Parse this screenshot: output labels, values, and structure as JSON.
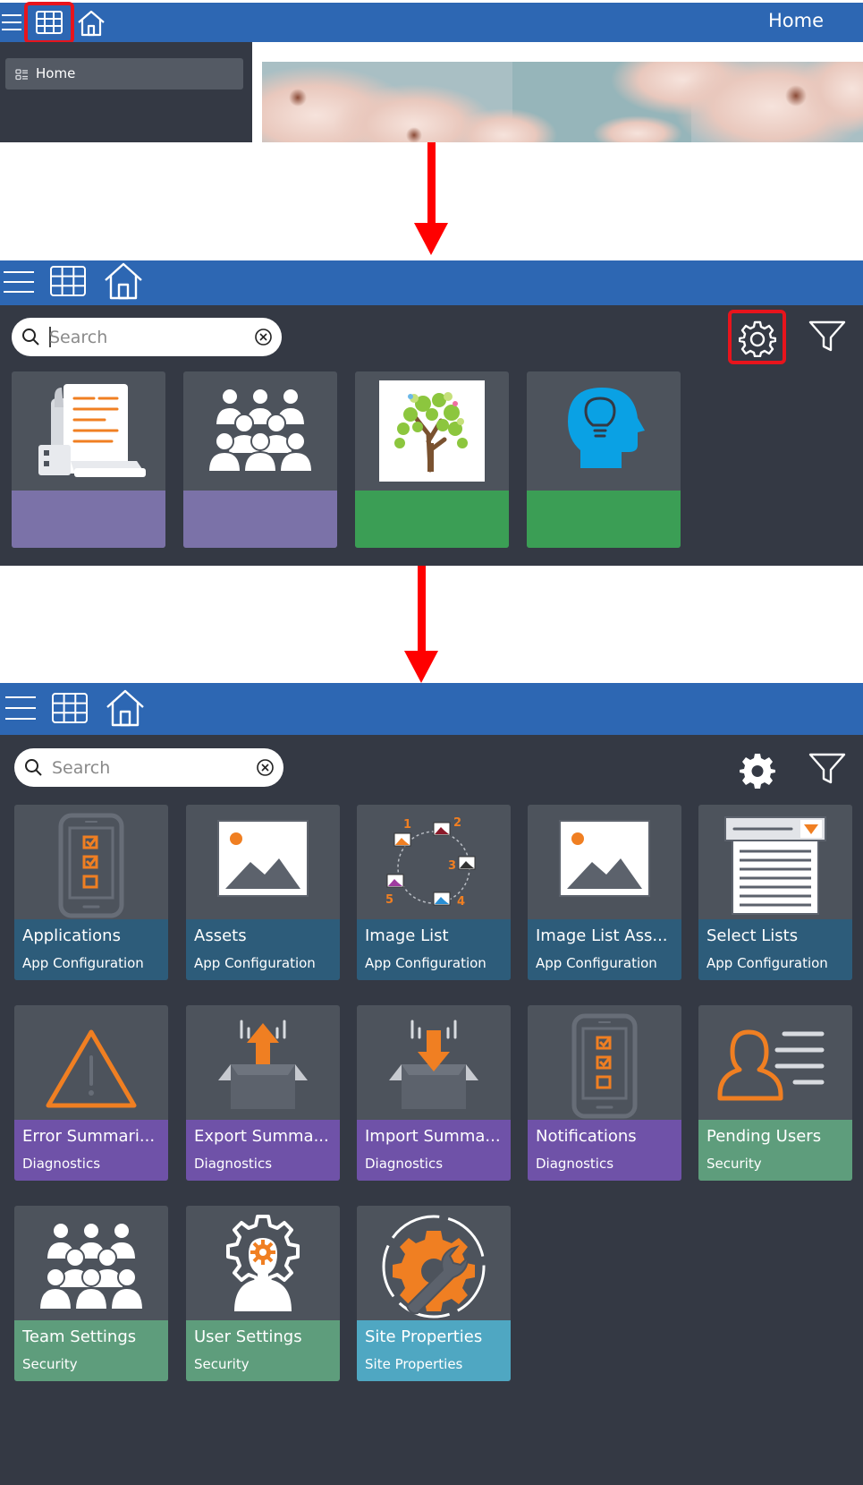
{
  "panel1": {
    "title": "Home",
    "sidebar": {
      "items": [
        {
          "label": "Home",
          "icon": "dashboard-icon"
        }
      ]
    },
    "topbar_icons": [
      "menu-icon",
      "grid-icon",
      "home-icon"
    ]
  },
  "panel2": {
    "search": {
      "placeholder": "Search",
      "value": ""
    },
    "tiles": [
      {
        "icon": "document-hands-icon",
        "band_color": "#7b72a8"
      },
      {
        "icon": "team-people-icon",
        "band_color": "#7b72a8"
      },
      {
        "icon": "tree-image-icon",
        "band_color": "#3b9e55"
      },
      {
        "icon": "lightbulb-head-icon",
        "band_color": "#3b9e55"
      }
    ]
  },
  "panel3": {
    "search": {
      "placeholder": "Search",
      "value": ""
    },
    "tiles": [
      {
        "title": "Applications",
        "category": "App Configuration",
        "icon": "phone-checklist-icon",
        "band_color": "#2d5c7a"
      },
      {
        "title": "Assets",
        "category": "App Configuration",
        "icon": "image-icon",
        "band_color": "#2d5c7a"
      },
      {
        "title": "Image List",
        "category": "App Configuration",
        "icon": "image-cycle-icon",
        "band_color": "#2d5c7a"
      },
      {
        "title": "Image List Ass...",
        "category": "App Configuration",
        "icon": "image-icon",
        "band_color": "#2d5c7a"
      },
      {
        "title": "Select Lists",
        "category": "App Configuration",
        "icon": "select-list-icon",
        "band_color": "#2d5c7a"
      },
      {
        "title": "Error Summari...",
        "category": "Diagnostics",
        "icon": "warning-icon",
        "band_color": "#6f52a8"
      },
      {
        "title": "Export Summa...",
        "category": "Diagnostics",
        "icon": "box-export-icon",
        "band_color": "#6f52a8"
      },
      {
        "title": "Import Summa...",
        "category": "Diagnostics",
        "icon": "box-import-icon",
        "band_color": "#6f52a8"
      },
      {
        "title": "Notifications",
        "category": "Diagnostics",
        "icon": "phone-checklist-icon",
        "band_color": "#6f52a8"
      },
      {
        "title": "Pending Users",
        "category": "Security",
        "icon": "user-card-icon",
        "band_color": "#5e9d7c"
      },
      {
        "title": "Team Settings",
        "category": "Security",
        "icon": "team-people-icon",
        "band_color": "#5e9d7c"
      },
      {
        "title": "User Settings",
        "category": "Security",
        "icon": "user-gear-icon",
        "band_color": "#5e9d7c"
      },
      {
        "title": "Site Properties",
        "category": "Site Properties",
        "icon": "gear-wrench-icon",
        "band_color": "#4fa7c2"
      }
    ],
    "image_list_numbers": [
      "1",
      "2",
      "3",
      "4",
      "5"
    ]
  },
  "colors": {
    "topbar": "#2d67b3",
    "panel_bg": "#343944",
    "tile_bg": "#4d535c",
    "highlight": "#e8141c",
    "arrow": "#ff0000",
    "accent_orange": "#f07f22"
  }
}
